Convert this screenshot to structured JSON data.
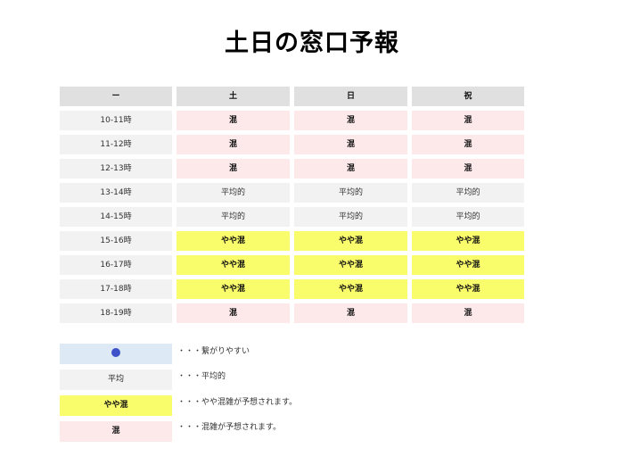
{
  "title": "土日の窓口予報",
  "table": {
    "headers": [
      "ー",
      "土",
      "日",
      "祝"
    ],
    "rows": [
      {
        "time": "10-11時",
        "values": [
          "混",
          "混",
          "混"
        ],
        "levels": [
          "crowded",
          "crowded",
          "crowded"
        ]
      },
      {
        "time": "11-12時",
        "values": [
          "混",
          "混",
          "混"
        ],
        "levels": [
          "crowded",
          "crowded",
          "crowded"
        ]
      },
      {
        "time": "12-13時",
        "values": [
          "混",
          "混",
          "混"
        ],
        "levels": [
          "crowded",
          "crowded",
          "crowded"
        ]
      },
      {
        "time": "13-14時",
        "values": [
          "平均的",
          "平均的",
          "平均的"
        ],
        "levels": [
          "average",
          "average",
          "average"
        ]
      },
      {
        "time": "14-15時",
        "values": [
          "平均的",
          "平均的",
          "平均的"
        ],
        "levels": [
          "average",
          "average",
          "average"
        ]
      },
      {
        "time": "15-16時",
        "values": [
          "やや混",
          "やや混",
          "やや混"
        ],
        "levels": [
          "slightly",
          "slightly",
          "slightly"
        ]
      },
      {
        "time": "16-17時",
        "values": [
          "やや混",
          "やや混",
          "やや混"
        ],
        "levels": [
          "slightly",
          "slightly",
          "slightly"
        ]
      },
      {
        "time": "17-18時",
        "values": [
          "やや混",
          "やや混",
          "やや混"
        ],
        "levels": [
          "slightly",
          "slightly",
          "slightly"
        ]
      },
      {
        "time": "18-19時",
        "values": [
          "混",
          "混",
          "混"
        ],
        "levels": [
          "crowded",
          "crowded",
          "crowded"
        ]
      }
    ]
  },
  "legend": {
    "items": [
      {
        "symbol": "",
        "icon": "blue-dot-icon",
        "description": "・・・繋がりやすい"
      },
      {
        "symbol": "平均",
        "description": "・・・平均的"
      },
      {
        "symbol": "やや混",
        "description": "・・・やや混雑が予想されます。"
      },
      {
        "symbol": "混",
        "description": "・・・混雑が予想されます。"
      }
    ]
  },
  "colors": {
    "header_bg": "#e0e0e0",
    "time_bg": "#f2f2f2",
    "crowded_bg": "#fde8ea",
    "average_bg": "#f2f2f2",
    "slightly_crowded_bg": "#fafd6b",
    "easy_bg": "#dde9f5",
    "dot": "#3f51c8"
  }
}
